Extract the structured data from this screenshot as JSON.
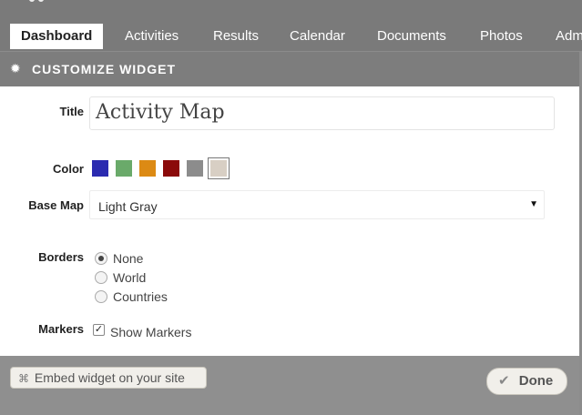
{
  "nav": {
    "tabs": [
      "Dashboard",
      "Activities",
      "Results",
      "Calendar",
      "Documents",
      "Photos",
      "Adm"
    ],
    "active_index": 0
  },
  "dialog": {
    "title": "CUSTOMIZE WIDGET",
    "fields": {
      "title_label": "Title",
      "title_value": "Activity Map",
      "color_label": "Color",
      "colors": [
        "#2b2bb0",
        "#6aaa6a",
        "#dc8a14",
        "#8b0a0a",
        "#8c8c8c",
        "#d8cfc4"
      ],
      "selected_color_index": 5,
      "base_map_label": "Base Map",
      "base_map_value": "Light Gray",
      "borders_label": "Borders",
      "borders_options": [
        "None",
        "World",
        "Countries"
      ],
      "borders_selected_index": 0,
      "markers_label": "Markers",
      "markers_checkbox_label": "Show Markers",
      "markers_checked": true
    },
    "footer": {
      "embed_label": "Embed widget on your site",
      "done_label": "Done"
    }
  }
}
